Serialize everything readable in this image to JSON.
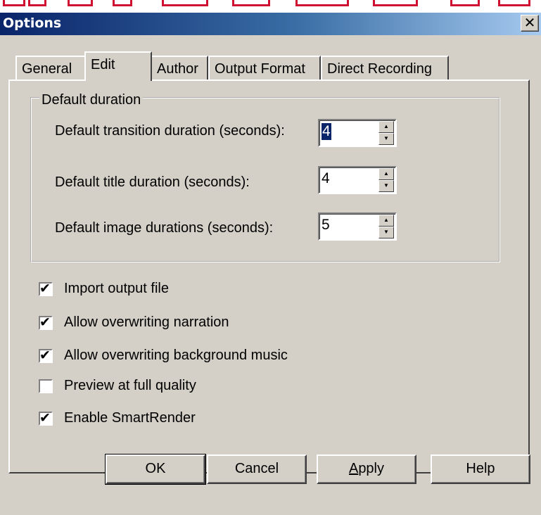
{
  "window": {
    "title": "Options",
    "close_label": "✕"
  },
  "tabs": [
    {
      "label": "General",
      "active": false
    },
    {
      "label": "Edit",
      "active": true
    },
    {
      "label": "Author",
      "active": false
    },
    {
      "label": "Output Format",
      "active": false
    },
    {
      "label": "Direct Recording",
      "active": false
    }
  ],
  "default_duration": {
    "legend": "Default duration",
    "rows": [
      {
        "label": "Default transition duration (seconds):",
        "value": "4",
        "selected": true
      },
      {
        "label": "Default title duration (seconds):",
        "value": "4",
        "selected": false
      },
      {
        "label": "Default image durations (seconds):",
        "value": "5",
        "selected": false
      }
    ],
    "spin_up_glyph": "▲",
    "spin_down_glyph": "▼"
  },
  "checkboxes": [
    {
      "label": "Import output file",
      "checked": true
    },
    {
      "label": "Allow overwriting narration",
      "checked": true
    },
    {
      "label": "Allow overwriting background music",
      "checked": true
    },
    {
      "label": "Preview at full quality",
      "checked": false
    },
    {
      "label": "Enable SmartRender",
      "checked": true
    }
  ],
  "check_glyph": "✔",
  "buttons": {
    "ok": "OK",
    "cancel": "Cancel",
    "apply_accel": "A",
    "apply_rest": "pply",
    "help": "Help"
  },
  "colors": {
    "dialog_bg": "#d4d0c8",
    "titlebar_start": "#0a246a",
    "titlebar_end": "#a6caf0",
    "selection": "#0a246a"
  }
}
